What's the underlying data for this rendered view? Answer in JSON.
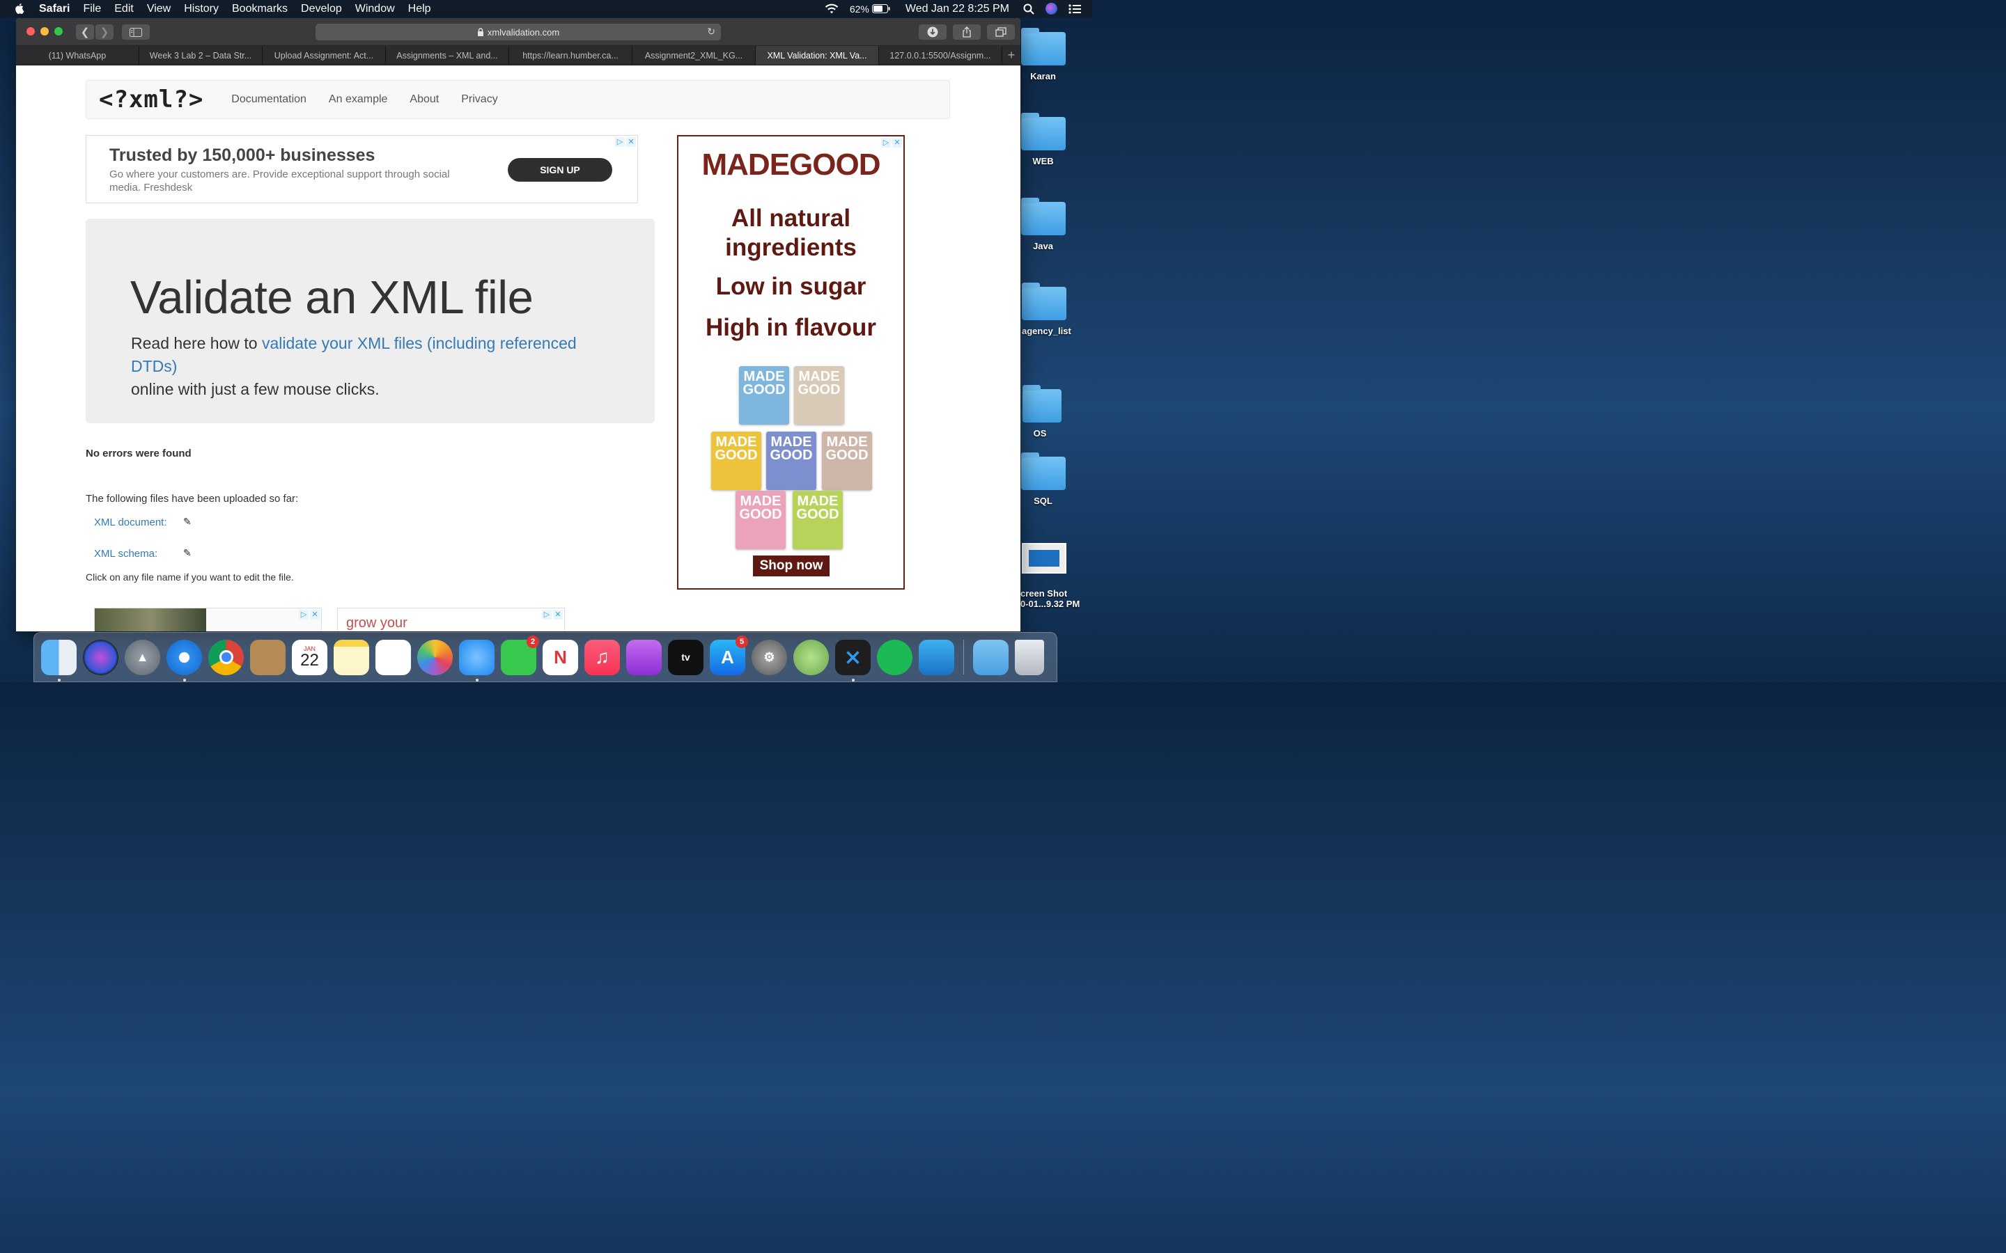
{
  "menubar": {
    "app": "Safari",
    "items": [
      "File",
      "Edit",
      "View",
      "History",
      "Bookmarks",
      "Develop",
      "Window",
      "Help"
    ],
    "battery": "62%",
    "clock": "Wed Jan 22  8:25 PM"
  },
  "browser": {
    "url": "xmlvalidation.com",
    "tabs": [
      "(11) WhatsApp",
      "Week 3 Lab 2 – Data Str...",
      "Upload Assignment: Act...",
      "Assignments – XML and...",
      "https://learn.humber.ca...",
      "Assignment2_XML_KG...",
      "XML Validation: XML Va...",
      "127.0.0.1:5500/Assignm..."
    ],
    "active_tab": 6
  },
  "page": {
    "brand": "<?xml?>",
    "nav": [
      "Documentation",
      "An example",
      "About",
      "Privacy"
    ],
    "ad_top": {
      "headline": "Trusted by 150,000+ businesses",
      "text": "Go where your customers are. Provide exceptional support through social media. Freshdesk",
      "button": "SIGN UP"
    },
    "jumbotron": {
      "title": "Validate an XML file",
      "lead_before": "Read here how to ",
      "lead_link": "validate your XML files (including referenced DTDs)",
      "lead_after": " online with just a few mouse clicks."
    },
    "result": "No errors were found",
    "files_intro": "The following files have been uploaded so far:",
    "files": [
      {
        "label": "XML document:"
      },
      {
        "label": "XML schema:"
      }
    ],
    "edit_hint": "Click on any file name if you want to edit the file.",
    "ad_bottom": {
      "text": "grow your"
    },
    "ad_side": {
      "brand": "MADEGOOD",
      "lines": [
        "All natural",
        "ingredients",
        "Low in sugar",
        "High in flavour"
      ],
      "pack_label": "MADE GOOD",
      "cta": "Shop now"
    }
  },
  "desktop": {
    "icons": [
      "Karan",
      "WEB",
      "Java",
      "agency_list",
      "OS",
      "SQL"
    ],
    "screenshot": {
      "line1": "creen Shot",
      "line2": "0-01...9.32 PM"
    }
  },
  "dock": {
    "calendar_month": "JAN",
    "calendar_day": "22",
    "tv_label": "tv",
    "badges": {
      "facetime": "2",
      "appstore": "5"
    }
  }
}
